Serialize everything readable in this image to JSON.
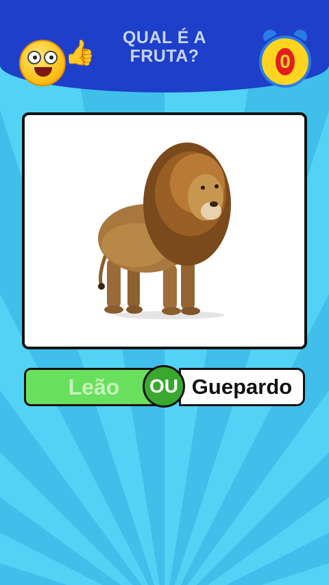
{
  "header": {
    "title_line1": "QUAL É A",
    "title_line2": "FRUTA?",
    "timer_value": "0"
  },
  "question": {
    "image_icon": "lion-illustration"
  },
  "answers": {
    "left_label": "Leão",
    "separator": "OU",
    "right_label": "Guepardo"
  },
  "colors": {
    "header_blue": "#1e3fc9",
    "background_cyan": "#49c6ee",
    "left_option_green": "#69df5e",
    "ou_badge_green": "#3aa82f",
    "clock_yellow": "#ffd51f",
    "clock_red": "#e21d1d"
  }
}
